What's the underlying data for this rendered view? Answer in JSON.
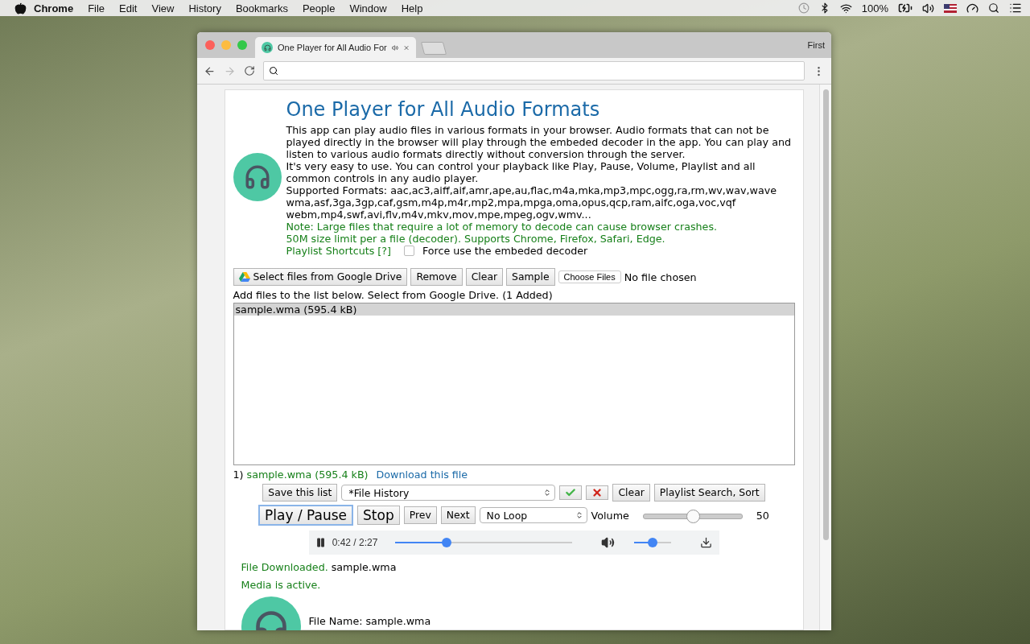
{
  "menubar": {
    "app": "Chrome",
    "items": [
      "File",
      "Edit",
      "View",
      "History",
      "Bookmarks",
      "People",
      "Window",
      "Help"
    ],
    "battery": "100%"
  },
  "browser": {
    "tab": {
      "title": "One Player for All Audio For",
      "audio_playing": true
    },
    "profile": "First"
  },
  "page": {
    "title": "One Player for All Audio Formats",
    "intro": [
      "This app can play audio files in various formats in your browser. Audio formats that can not be played directly in the browser will play through the embeded decoder in the app. You can play and listen to various audio formats directly without conversion through the server.",
      "It's very easy to use. You can control your playback like Play, Pause, Volume, Playlist and all common controls in any audio player."
    ],
    "formats": [
      "Supported Formats: aac,ac3,aiff,aif,amr,ape,au,flac,m4a,mka,mp3,mpc,ogg,ra,rm,wv,wav,wave",
      "wma,asf,3ga,3gp,caf,gsm,m4p,m4r,mp2,mpa,mpga,oma,opus,qcp,ram,aifc,oga,voc,vqf",
      "webm,mp4,swf,avi,flv,m4v,mkv,mov,mpe,mpeg,ogv,wmv..."
    ],
    "notes": [
      "Note: Large files that require a lot of memory to decode can cause browser crashes.",
      "50M size limit per a file (decoder). Supports Chrome, Firefox, Safari, Edge."
    ],
    "shortcuts_link": "Playlist Shortcuts [?]",
    "force_decoder": {
      "label": "Force use the embeded decoder",
      "checked": false
    },
    "file_buttons": [
      {
        "label": "Select files from Google Drive",
        "kind": "drive"
      },
      {
        "label": "Remove",
        "kind": "plain"
      },
      {
        "label": "Clear",
        "kind": "plain"
      },
      {
        "label": "Sample",
        "kind": "plain"
      }
    ],
    "file_input": {
      "button": "Choose Files",
      "status": "No file chosen"
    },
    "hint": "Add files to the list below. Select from Google Drive. (1 Added)",
    "playlist": [
      {
        "label": "sample.wma (595.4 kB)",
        "selected": true
      }
    ],
    "current": {
      "index": "1)",
      "file": "sample.wma (595.4 kB)",
      "link": "Download this file"
    },
    "list_controls": {
      "save": "Save this list",
      "history": "*File History",
      "clear": "Clear",
      "search": "Playlist Search, Sort"
    },
    "transport": {
      "play_pause": {
        "label": "Play / Pause",
        "focused": true
      },
      "stop": "Stop",
      "prev": "Prev",
      "next": "Next",
      "loop": "No Loop",
      "volume_label": "Volume",
      "volume": {
        "level": 0.5
      },
      "volume_reading": "50"
    },
    "audio": {
      "playing": true,
      "time": "0:42 / 2:27",
      "progress": {
        "level": 0.29
      },
      "volume": {
        "level": 0.5
      }
    },
    "status": [
      {
        "label": "File Downloaded.",
        "value": "sample.wma"
      },
      {
        "label": "Media is active."
      }
    ],
    "file_info": "File Name: sample.wma"
  }
}
